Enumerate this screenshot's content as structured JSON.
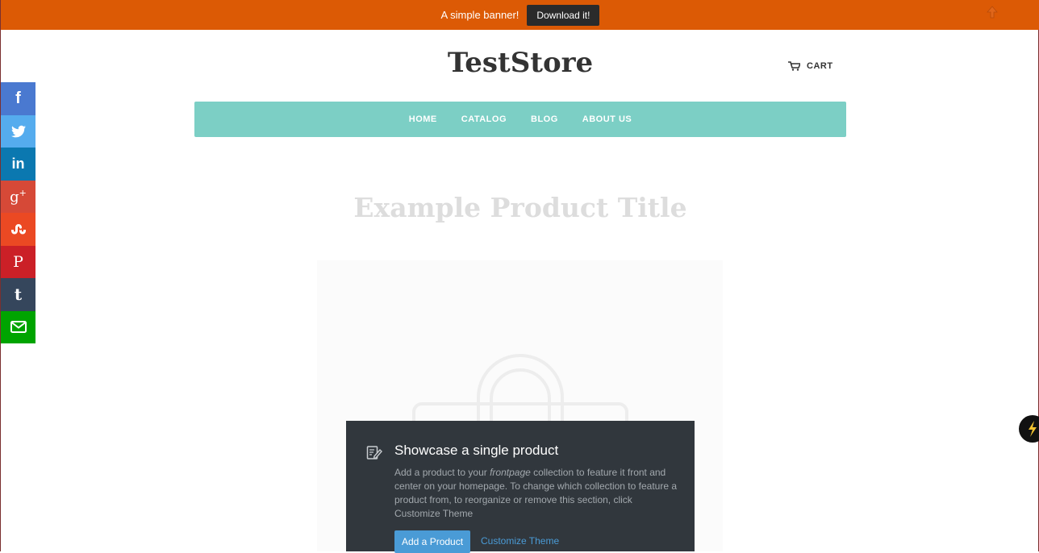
{
  "banner": {
    "text": "A simple banner!",
    "button_label": "Download it!",
    "up_icon": "arrow-up-icon",
    "bg_color": "#dc5a05"
  },
  "header": {
    "logo": "TestStore",
    "cart_label": "CART",
    "cart_icon": "cart-icon"
  },
  "nav": {
    "bg_color": "#7ccfc5",
    "items": [
      {
        "label": "HOME"
      },
      {
        "label": "CATALOG"
      },
      {
        "label": "BLOG"
      },
      {
        "label": "ABOUT US"
      }
    ]
  },
  "product": {
    "title": "Example Product Title",
    "image_icon": "bag-placeholder-icon"
  },
  "social": [
    {
      "name": "facebook",
      "glyph": "f",
      "color": "#4a79d0"
    },
    {
      "name": "twitter",
      "glyph": "twitter-bird",
      "color": "#55acee"
    },
    {
      "name": "linkedin",
      "glyph": "in",
      "color": "#0b78b0"
    },
    {
      "name": "google-plus",
      "glyph": "g+",
      "color": "#d64937"
    },
    {
      "name": "stumbleupon",
      "glyph": "su",
      "color": "#eb4923"
    },
    {
      "name": "pinterest",
      "glyph": "P",
      "color": "#cb2027"
    },
    {
      "name": "tumblr",
      "glyph": "t",
      "color": "#35465c"
    },
    {
      "name": "email",
      "glyph": "envelope",
      "color": "#00a400"
    }
  ],
  "overlay": {
    "icon": "edit-document-icon",
    "title": "Showcase a single product",
    "body_pre": "Add a product to your ",
    "body_em": "frontpage",
    "body_post": " collection to feature it front and center on your homepage. To change which collection to feature a product from, to reorganize or remove this section, click Customize Theme",
    "add_button": "Add a Product",
    "customize_link": "Customize Theme",
    "button_color": "#4a9bd6"
  },
  "chat_badge": {
    "icon": "lightning-chat-icon"
  }
}
